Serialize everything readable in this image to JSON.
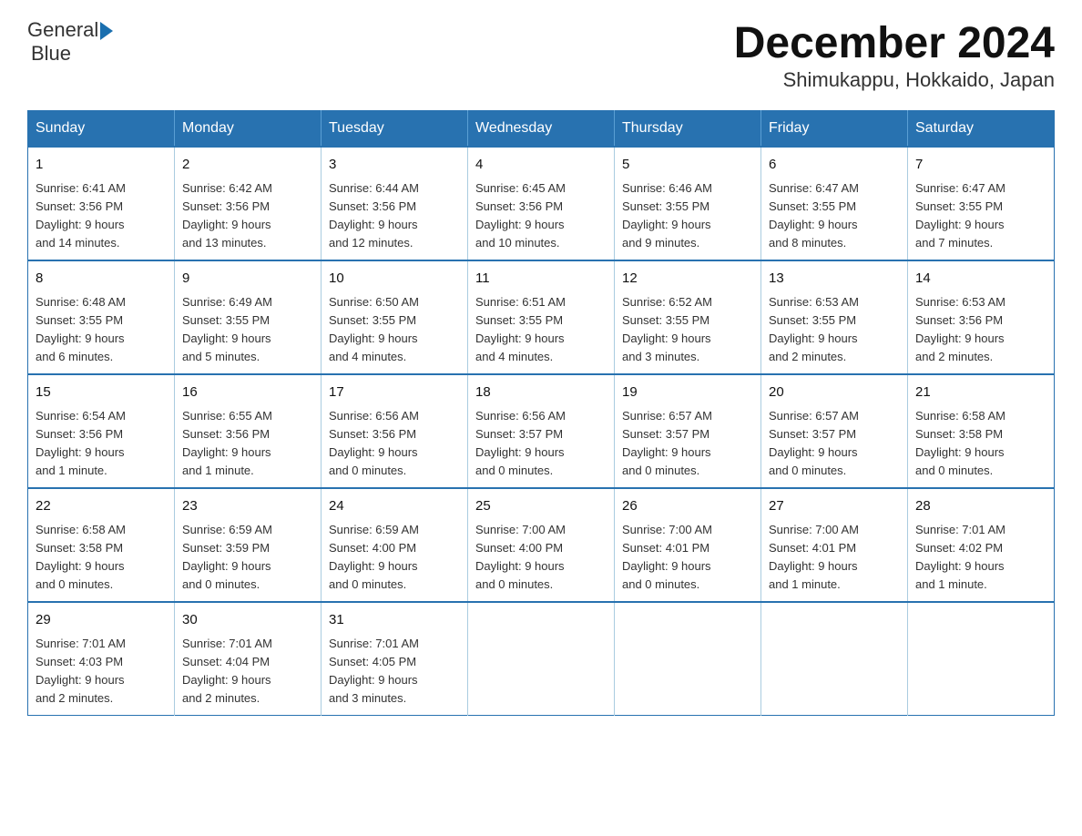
{
  "header": {
    "logo_general": "General",
    "logo_blue": "Blue",
    "title": "December 2024",
    "subtitle": "Shimukappu, Hokkaido, Japan"
  },
  "weekdays": [
    "Sunday",
    "Monday",
    "Tuesday",
    "Wednesday",
    "Thursday",
    "Friday",
    "Saturday"
  ],
  "weeks": [
    [
      {
        "day": "1",
        "info": "Sunrise: 6:41 AM\nSunset: 3:56 PM\nDaylight: 9 hours\nand 14 minutes."
      },
      {
        "day": "2",
        "info": "Sunrise: 6:42 AM\nSunset: 3:56 PM\nDaylight: 9 hours\nand 13 minutes."
      },
      {
        "day": "3",
        "info": "Sunrise: 6:44 AM\nSunset: 3:56 PM\nDaylight: 9 hours\nand 12 minutes."
      },
      {
        "day": "4",
        "info": "Sunrise: 6:45 AM\nSunset: 3:56 PM\nDaylight: 9 hours\nand 10 minutes."
      },
      {
        "day": "5",
        "info": "Sunrise: 6:46 AM\nSunset: 3:55 PM\nDaylight: 9 hours\nand 9 minutes."
      },
      {
        "day": "6",
        "info": "Sunrise: 6:47 AM\nSunset: 3:55 PM\nDaylight: 9 hours\nand 8 minutes."
      },
      {
        "day": "7",
        "info": "Sunrise: 6:47 AM\nSunset: 3:55 PM\nDaylight: 9 hours\nand 7 minutes."
      }
    ],
    [
      {
        "day": "8",
        "info": "Sunrise: 6:48 AM\nSunset: 3:55 PM\nDaylight: 9 hours\nand 6 minutes."
      },
      {
        "day": "9",
        "info": "Sunrise: 6:49 AM\nSunset: 3:55 PM\nDaylight: 9 hours\nand 5 minutes."
      },
      {
        "day": "10",
        "info": "Sunrise: 6:50 AM\nSunset: 3:55 PM\nDaylight: 9 hours\nand 4 minutes."
      },
      {
        "day": "11",
        "info": "Sunrise: 6:51 AM\nSunset: 3:55 PM\nDaylight: 9 hours\nand 4 minutes."
      },
      {
        "day": "12",
        "info": "Sunrise: 6:52 AM\nSunset: 3:55 PM\nDaylight: 9 hours\nand 3 minutes."
      },
      {
        "day": "13",
        "info": "Sunrise: 6:53 AM\nSunset: 3:55 PM\nDaylight: 9 hours\nand 2 minutes."
      },
      {
        "day": "14",
        "info": "Sunrise: 6:53 AM\nSunset: 3:56 PM\nDaylight: 9 hours\nand 2 minutes."
      }
    ],
    [
      {
        "day": "15",
        "info": "Sunrise: 6:54 AM\nSunset: 3:56 PM\nDaylight: 9 hours\nand 1 minute."
      },
      {
        "day": "16",
        "info": "Sunrise: 6:55 AM\nSunset: 3:56 PM\nDaylight: 9 hours\nand 1 minute."
      },
      {
        "day": "17",
        "info": "Sunrise: 6:56 AM\nSunset: 3:56 PM\nDaylight: 9 hours\nand 0 minutes."
      },
      {
        "day": "18",
        "info": "Sunrise: 6:56 AM\nSunset: 3:57 PM\nDaylight: 9 hours\nand 0 minutes."
      },
      {
        "day": "19",
        "info": "Sunrise: 6:57 AM\nSunset: 3:57 PM\nDaylight: 9 hours\nand 0 minutes."
      },
      {
        "day": "20",
        "info": "Sunrise: 6:57 AM\nSunset: 3:57 PM\nDaylight: 9 hours\nand 0 minutes."
      },
      {
        "day": "21",
        "info": "Sunrise: 6:58 AM\nSunset: 3:58 PM\nDaylight: 9 hours\nand 0 minutes."
      }
    ],
    [
      {
        "day": "22",
        "info": "Sunrise: 6:58 AM\nSunset: 3:58 PM\nDaylight: 9 hours\nand 0 minutes."
      },
      {
        "day": "23",
        "info": "Sunrise: 6:59 AM\nSunset: 3:59 PM\nDaylight: 9 hours\nand 0 minutes."
      },
      {
        "day": "24",
        "info": "Sunrise: 6:59 AM\nSunset: 4:00 PM\nDaylight: 9 hours\nand 0 minutes."
      },
      {
        "day": "25",
        "info": "Sunrise: 7:00 AM\nSunset: 4:00 PM\nDaylight: 9 hours\nand 0 minutes."
      },
      {
        "day": "26",
        "info": "Sunrise: 7:00 AM\nSunset: 4:01 PM\nDaylight: 9 hours\nand 0 minutes."
      },
      {
        "day": "27",
        "info": "Sunrise: 7:00 AM\nSunset: 4:01 PM\nDaylight: 9 hours\nand 1 minute."
      },
      {
        "day": "28",
        "info": "Sunrise: 7:01 AM\nSunset: 4:02 PM\nDaylight: 9 hours\nand 1 minute."
      }
    ],
    [
      {
        "day": "29",
        "info": "Sunrise: 7:01 AM\nSunset: 4:03 PM\nDaylight: 9 hours\nand 2 minutes."
      },
      {
        "day": "30",
        "info": "Sunrise: 7:01 AM\nSunset: 4:04 PM\nDaylight: 9 hours\nand 2 minutes."
      },
      {
        "day": "31",
        "info": "Sunrise: 7:01 AM\nSunset: 4:05 PM\nDaylight: 9 hours\nand 3 minutes."
      },
      {
        "day": "",
        "info": ""
      },
      {
        "day": "",
        "info": ""
      },
      {
        "day": "",
        "info": ""
      },
      {
        "day": "",
        "info": ""
      }
    ]
  ]
}
